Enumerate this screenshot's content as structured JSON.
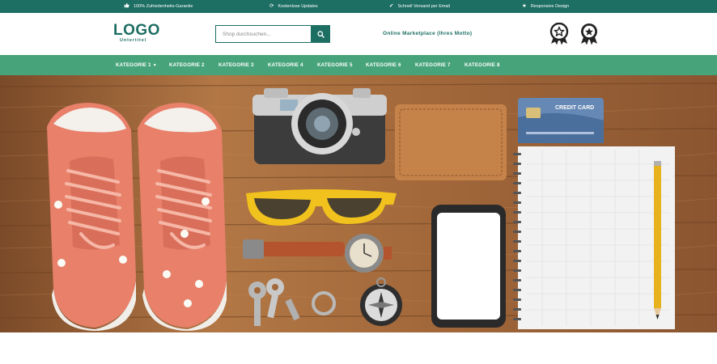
{
  "topbar": {
    "usps": [
      {
        "icon": "thumbs-up-icon",
        "glyph": "👍︎",
        "label": "100% Zufriedenheits-Garantie"
      },
      {
        "icon": "refresh-icon",
        "glyph": "⟳",
        "label": "Kostenlose Updates"
      },
      {
        "icon": "check-icon",
        "glyph": "✔",
        "label": "Schnell Versand per Email"
      },
      {
        "icon": "star-icon",
        "glyph": "★",
        "label": "Responsive Design"
      }
    ]
  },
  "header": {
    "logo_text": "LOGO",
    "logo_subtitle": "Untertitel",
    "search_placeholder": "Shop durchsuchen...",
    "search_icon": "search-icon",
    "motto": "Online Marketplace (Ihres Motto)",
    "badges": [
      "award-star-outline-icon",
      "award-star-filled-icon"
    ]
  },
  "nav": {
    "items": [
      {
        "label": "KATEGORIE 1",
        "has_dropdown": true
      },
      {
        "label": "KATEGORIE 2"
      },
      {
        "label": "KATEGORIE 3"
      },
      {
        "label": "KATEGORIE 4"
      },
      {
        "label": "KATEGORIE 5"
      },
      {
        "label": "KATEGORIE 6"
      },
      {
        "label": "KATEGORIE 7"
      },
      {
        "label": "KATEGORIE 8"
      }
    ]
  },
  "hero": {
    "card_text": "CREDIT CARD"
  },
  "colors": {
    "topbar": "#1d6e63",
    "brand": "#1d6e63",
    "nav": "#47a47a",
    "hero_wood": "#a5693a"
  }
}
